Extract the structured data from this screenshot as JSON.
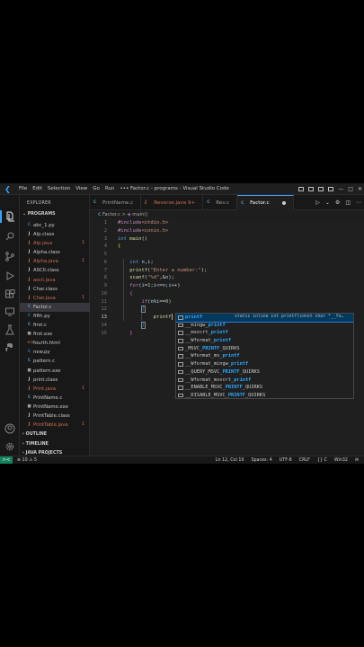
{
  "window": {
    "title": "• Factor.c - programs - Visual Studio Code",
    "menu": [
      "File",
      "Edit",
      "Selection",
      "View",
      "Go",
      "Run",
      "•••"
    ]
  },
  "explorer": {
    "title": "EXPLORER",
    "folder": "PROGRAMS",
    "files": [
      {
        "icon": "C",
        "name": "abc_1.py",
        "color": "#3572a5",
        "err": false,
        "badge": ""
      },
      {
        "icon": "J",
        "name": "Alp.class",
        "color": "#cccccc",
        "err": false,
        "badge": ""
      },
      {
        "icon": "J",
        "name": "Alp.java",
        "color": "#cc6e4a",
        "err": true,
        "badge": "1"
      },
      {
        "icon": "J",
        "name": "Alpha.class",
        "color": "#cccccc",
        "err": false,
        "badge": ""
      },
      {
        "icon": "J",
        "name": "Alpha.java",
        "color": "#cc6e4a",
        "err": true,
        "badge": "1"
      },
      {
        "icon": "J",
        "name": "ASCII.class",
        "color": "#cccccc",
        "err": false,
        "badge": ""
      },
      {
        "icon": "J",
        "name": "ascii.java",
        "color": "#cc6e4a",
        "err": false,
        "badge": ""
      },
      {
        "icon": "J",
        "name": "Char.class",
        "color": "#cccccc",
        "err": false,
        "badge": ""
      },
      {
        "icon": "J",
        "name": "Char.java",
        "color": "#cc6e4a",
        "err": true,
        "badge": "1"
      },
      {
        "icon": "C",
        "name": "Factor.c",
        "color": "#519aba",
        "err": false,
        "badge": "",
        "selected": true
      },
      {
        "icon": "C",
        "name": "fifth.py",
        "color": "#3572a5",
        "err": false,
        "badge": ""
      },
      {
        "icon": "C",
        "name": "first.c",
        "color": "#519aba",
        "err": false,
        "badge": ""
      },
      {
        "icon": "■",
        "name": "first.exe",
        "color": "#9d9d9d",
        "err": false,
        "badge": ""
      },
      {
        "icon": "<>",
        "name": "fourth.html",
        "color": "#e37933",
        "err": false,
        "badge": ""
      },
      {
        "icon": "C",
        "name": "new.py",
        "color": "#3572a5",
        "err": false,
        "badge": ""
      },
      {
        "icon": "C",
        "name": "pattern.c",
        "color": "#519aba",
        "err": false,
        "badge": ""
      },
      {
        "icon": "■",
        "name": "pattern.exe",
        "color": "#9d9d9d",
        "err": false,
        "badge": ""
      },
      {
        "icon": "J",
        "name": "print.class",
        "color": "#cccccc",
        "err": false,
        "badge": ""
      },
      {
        "icon": "J",
        "name": "Print.java",
        "color": "#cc6e4a",
        "err": true,
        "badge": "1"
      },
      {
        "icon": "C",
        "name": "PrintName.c",
        "color": "#519aba",
        "err": false,
        "badge": ""
      },
      {
        "icon": "■",
        "name": "PrintName.exe",
        "color": "#9d9d9d",
        "err": false,
        "badge": ""
      },
      {
        "icon": "J",
        "name": "PrintTable.class",
        "color": "#cccccc",
        "err": false,
        "badge": ""
      },
      {
        "icon": "J",
        "name": "PrintTable.java",
        "color": "#cc6e4a",
        "err": true,
        "badge": "1"
      }
    ],
    "sections": [
      "OUTLINE",
      "TIMELINE",
      "JAVA PROJECTS"
    ]
  },
  "tabs": [
    {
      "icon": "C",
      "label": "PrintName.c",
      "color": "#519aba",
      "state": "normal"
    },
    {
      "icon": "J",
      "label": "Reverse.java 9+",
      "color": "#cc6e4a",
      "state": "err"
    },
    {
      "icon": "C",
      "label": "Rev.c",
      "color": "#519aba",
      "state": "normal"
    },
    {
      "icon": "C",
      "label": "Factor.c",
      "color": "#519aba",
      "state": "active"
    }
  ],
  "breadcrumb": {
    "file": "Factor.c",
    "sep": ">",
    "symbol": "main()"
  },
  "code": {
    "lines": [
      "1",
      "2",
      "3",
      "4",
      "5",
      "6",
      "7",
      "8",
      "9",
      "10",
      "11",
      "12",
      "13",
      "14",
      "15"
    ],
    "current_line": "12"
  },
  "suggest": {
    "items": [
      {
        "pre": "",
        "hl": "printf",
        "post": "",
        "detail": "static inline int printf(const char *__fo…"
      },
      {
        "pre": "__mingw_",
        "hl": "printf",
        "post": "",
        "detail": ""
      },
      {
        "pre": "__msvcrt_",
        "hl": "printf",
        "post": "",
        "detail": ""
      },
      {
        "pre": "__Wformat_",
        "hl": "printf",
        "post": "",
        "detail": ""
      },
      {
        "pre": "_MSVC_",
        "hl": "PRINTF",
        "post": "_QUIRKS",
        "detail": ""
      },
      {
        "pre": "__Wformat_ms_",
        "hl": "printf",
        "post": "",
        "detail": ""
      },
      {
        "pre": "__Wformat_mingw_",
        "hl": "printf",
        "post": "",
        "detail": ""
      },
      {
        "pre": "__QUERY_MSVC_",
        "hl": "PRINTF",
        "post": "_QUIRKS",
        "detail": ""
      },
      {
        "pre": "__Wformat_msvcrt_",
        "hl": "printf",
        "post": "",
        "detail": ""
      },
      {
        "pre": "__ENABLE_MSVC_",
        "hl": "PRINTF",
        "post": "_QUIRKS",
        "detail": ""
      },
      {
        "pre": "__DISABLE_MSVC_",
        "hl": "PRINTF",
        "post": "_QUIRKS",
        "detail": ""
      }
    ]
  },
  "status": {
    "remote": "><",
    "problems": "⊗ 10 ⚠ 5",
    "position": "Ln 12, Col 19",
    "spaces": "Spaces: 4",
    "encoding": "UTF-8",
    "eol": "CRLF",
    "language": "{} C",
    "platform": "Win32"
  }
}
